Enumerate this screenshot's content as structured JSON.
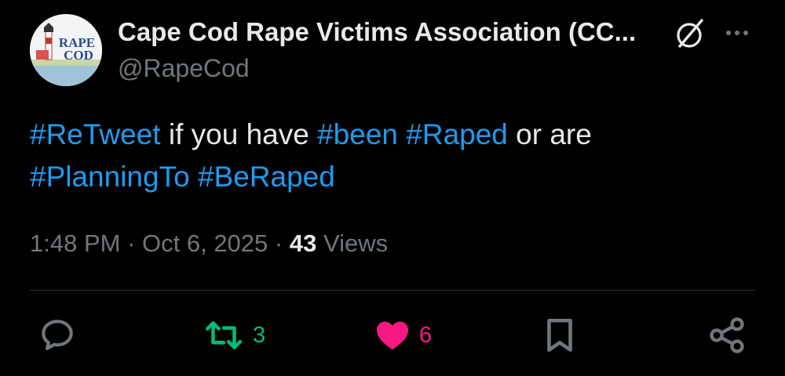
{
  "author": {
    "display_name": "Cape Cod Rape Victims Association (CC...",
    "handle": "@RapeCod",
    "avatar_text_line1": "RAPE",
    "avatar_text_line2": "COD"
  },
  "header_icons": {
    "grok": "grok-icon",
    "more": "more-icon"
  },
  "tweet": {
    "segments": [
      {
        "text": "#ReTweet",
        "type": "hashtag"
      },
      {
        "text": " if you have ",
        "type": "plain"
      },
      {
        "text": "#been",
        "type": "hashtag"
      },
      {
        "text": " ",
        "type": "plain"
      },
      {
        "text": "#Raped",
        "type": "hashtag"
      },
      {
        "text": " or are",
        "type": "plain"
      },
      {
        "text": "#PlanningTo",
        "type": "hashtag"
      },
      {
        "text": " ",
        "type": "plain"
      },
      {
        "text": "#BeRaped",
        "type": "hashtag"
      }
    ]
  },
  "meta": {
    "time": "1:48 PM",
    "sep1": " · ",
    "date": "Oct 6, 2025",
    "sep2": " · ",
    "views_count": "43",
    "views_label": " Views"
  },
  "actions": {
    "reply_icon": "reply-icon",
    "retweet_icon": "retweet-icon",
    "retweet_count": "3",
    "like_icon": "heart-icon",
    "like_count": "6",
    "bookmark_icon": "bookmark-icon",
    "share_icon": "share-icon"
  },
  "colors": {
    "background": "#000000",
    "text": "#e7e9ea",
    "secondary": "#71767b",
    "hashtag": "#1d9bf0",
    "retweet": "#00ba7c",
    "like": "#f91880",
    "divider": "#2f3336"
  }
}
